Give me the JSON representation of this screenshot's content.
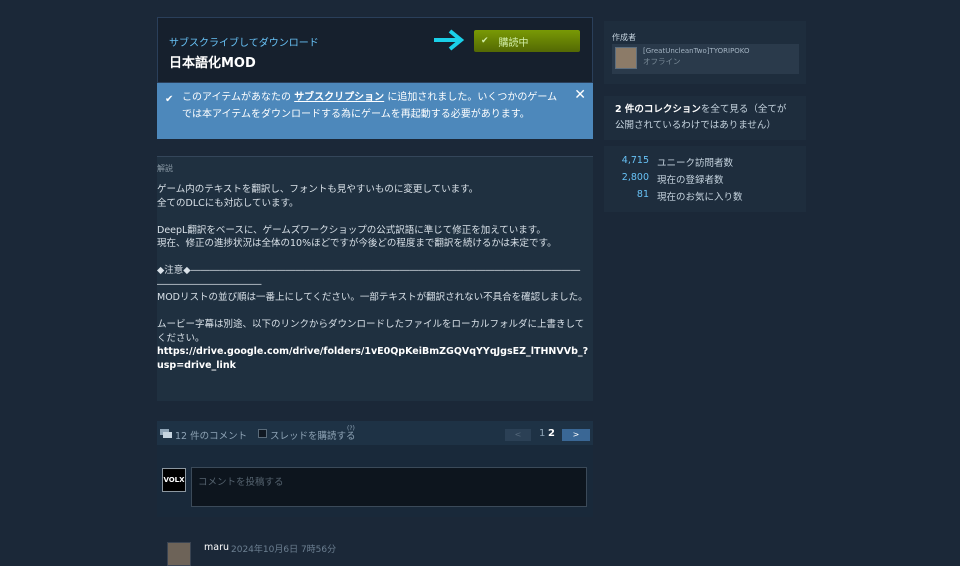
{
  "subscribe": {
    "caption": "サブスクライブしてダウンロード",
    "title": "日本語化MOD",
    "button_label": "購読中"
  },
  "notice": {
    "text_before": "このアイテムがあなたの",
    "link": "サブスクリプション",
    "text_after": "に追加されました。いくつかのゲームでは本アイテムをダウンロードする為にゲームを再起動する必要があります。",
    "close": "✕"
  },
  "description": {
    "heading": "解説",
    "line1": "ゲーム内のテキストを翻訳し、フォントも見やすいものに変更しています。",
    "line2": "全てのDLCにも対応しています。",
    "line3": "DeepL翻訳をベースに、ゲームズワークショップの公式訳語に準じて修正を加えています。",
    "line4": "現在、修正の進捗状況は全体の10%ほどですが今後どの程度まで翻訳を続けるかは未定です。",
    "notice_rule": "◆注意◆――――――――――――――――――――――――――――――――――――――――――――――――――――",
    "line5": "MODリストの並び順は一番上にしてください。一部テキストが翻訳されない不具合を確認しました。",
    "line6": "ムービー字幕は別途、以下のリンクからダウンロードしたファイルをローカルフォルダに上書きしてください。",
    "link": "https://drive.google.com/drive/folders/1vE0QpKeiBmZGQVqYYqJgsEZ_lTHNVVb_?usp=drive_link"
  },
  "comments": {
    "count_label": "12 件のコメント",
    "subscribe_thread": "スレッドを購読する",
    "help": "(?)",
    "prev": "<",
    "page1": "1",
    "page2": "2",
    "next": ">",
    "self_avatar": "VOLX",
    "input_placeholder": "コメントを投稿する"
  },
  "first_comment": {
    "name": "maru",
    "time": "2024年10月6日 7時56分"
  },
  "author": {
    "label": "作成者",
    "name": "[GreatUncleanTwo]TYORIPOKO",
    "status": "オフライン"
  },
  "collections": {
    "count": "2 件のコレクション",
    "text": "を全て見る（全てが公開されているわけではありません）"
  },
  "stats": [
    {
      "value": "4,715",
      "label": "ユニーク訪問者数"
    },
    {
      "value": "2,800",
      "label": "現在の登録者数"
    },
    {
      "value": "81",
      "label": "現在のお気に入り数"
    }
  ],
  "colors": {
    "background": "#1b2838",
    "accent_blue": "#67c1f5",
    "subscribed_green": "#799905",
    "notice_blue": "#4d88bb",
    "arrow_cyan": "#1ad0e8"
  }
}
